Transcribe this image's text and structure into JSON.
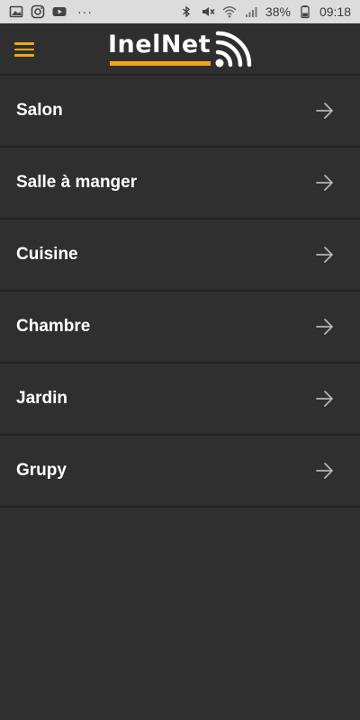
{
  "status_bar": {
    "left_icons": [
      "gallery-icon",
      "instagram-icon",
      "youtube-icon"
    ],
    "more_dots": "···",
    "right_icons": [
      "bluetooth-icon",
      "mute-icon",
      "wifi-icon",
      "signal-icon"
    ],
    "battery_percent": "38%",
    "time": "09:18"
  },
  "header": {
    "menu_icon": "hamburger-menu-icon",
    "logo_text": "InelNet",
    "logo_icon": "wifi-signal-icon",
    "colors": {
      "accent": "#f0a814",
      "background": "#2f2f2f",
      "text": "#ffffff"
    }
  },
  "rooms": [
    {
      "label": "Salon",
      "icon": "arrow-right-icon"
    },
    {
      "label": "Salle à manger",
      "icon": "arrow-right-icon"
    },
    {
      "label": "Cuisine",
      "icon": "arrow-right-icon"
    },
    {
      "label": "Chambre",
      "icon": "arrow-right-icon"
    },
    {
      "label": "Jardin",
      "icon": "arrow-right-icon"
    },
    {
      "label": "Grupy",
      "icon": "arrow-right-icon"
    }
  ]
}
